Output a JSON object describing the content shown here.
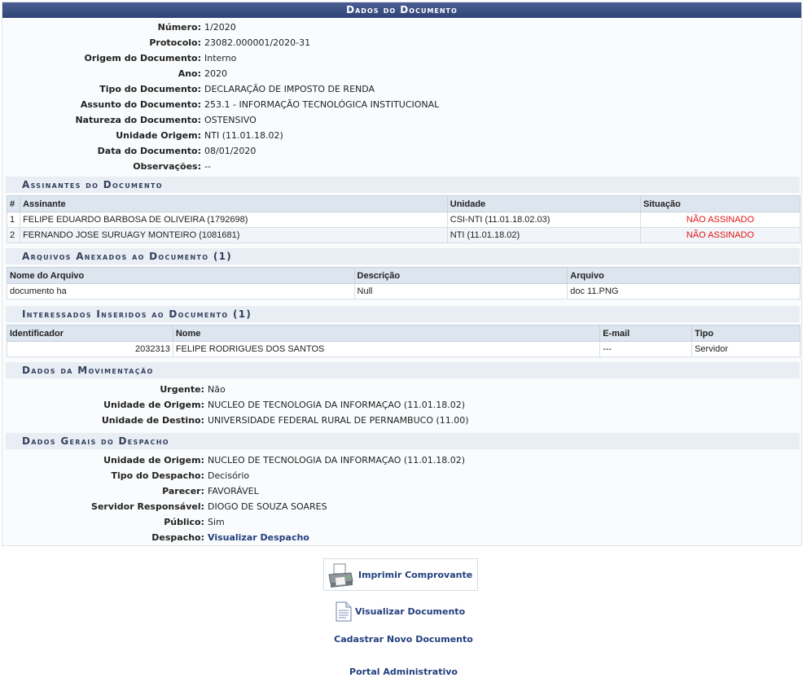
{
  "title": "Dados do Documento",
  "document": [
    {
      "label": "Número:",
      "value": "1/2020"
    },
    {
      "label": "Protocolo:",
      "value": "23082.000001/2020-31"
    },
    {
      "label": "Origem do Documento:",
      "value": "Interno"
    },
    {
      "label": "Ano:",
      "value": "2020"
    },
    {
      "label": "Tipo do Documento:",
      "value": "DECLARAÇÃO DE IMPOSTO DE RENDA"
    },
    {
      "label": "Assunto do Documento:",
      "value": "253.1 - INFORMAÇÃO TECNOLÓGICA INSTITUCIONAL"
    },
    {
      "label": "Natureza do Documento:",
      "value": "OSTENSIVO"
    },
    {
      "label": "Unidade Origem:",
      "value": "NTI (11.01.18.02)"
    },
    {
      "label": "Data do Documento:",
      "value": "08/01/2020"
    },
    {
      "label": "Observações:",
      "value": "--"
    }
  ],
  "signers": {
    "heading": "Assinantes do Documento",
    "columns": [
      "#",
      "Assinante",
      "Unidade",
      "Situação"
    ],
    "rows": [
      {
        "n": "1",
        "name": "FELIPE EDUARDO BARBOSA DE OLIVEIRA (1792698)",
        "unit": "CSI-NTI (11.01.18.02.03)",
        "status": "NÃO ASSINADO"
      },
      {
        "n": "2",
        "name": "FERNANDO JOSE SURUAGY MONTEIRO (1081681)",
        "unit": "NTI (11.01.18.02)",
        "status": "NÃO ASSINADO"
      }
    ]
  },
  "attachments": {
    "heading": "Arquivos Anexados ao Documento (1)",
    "columns": [
      "Nome do Arquivo",
      "Descrição",
      "Arquivo"
    ],
    "rows": [
      {
        "name": "documento ha",
        "desc": "Null",
        "file": "doc 11.PNG"
      }
    ]
  },
  "interested": {
    "heading": "Interessados Inseridos ao Documento (1)",
    "columns": [
      "Identificador",
      "Nome",
      "E-mail",
      "Tipo"
    ],
    "rows": [
      {
        "id": "2032313",
        "name": "FELIPE RODRIGUES DOS SANTOS",
        "email": "---",
        "type": "Servidor"
      }
    ]
  },
  "movement": {
    "heading": "Dados da Movimentação",
    "items": [
      {
        "label": "Urgente:",
        "value": "Não"
      },
      {
        "label": "Unidade de Origem:",
        "value": "NUCLEO DE TECNOLOGIA DA INFORMAÇAO (11.01.18.02)"
      },
      {
        "label": "Unidade de Destino:",
        "value": "UNIVERSIDADE FEDERAL RURAL DE PERNAMBUCO (11.00)"
      }
    ]
  },
  "dispatch": {
    "heading": "Dados Gerais do Despacho",
    "items": [
      {
        "label": "Unidade de Origem:",
        "value": "NUCLEO DE TECNOLOGIA DA INFORMAÇAO (11.01.18.02)"
      },
      {
        "label": "Tipo do Despacho:",
        "value": "Decisório"
      },
      {
        "label": "Parecer:",
        "value": "FAVORÁVEL"
      },
      {
        "label": "Servidor Responsável:",
        "value": "DIOGO DE SOUZA SOARES"
      },
      {
        "label": "Público:",
        "value": "Sim"
      }
    ],
    "despacho_label": "Despacho:",
    "despacho_link": "Visualizar Despacho"
  },
  "actions": {
    "print": "Imprimir Comprovante",
    "view_document": "Visualizar Documento",
    "new_document": "Cadastrar Novo Documento",
    "admin_portal": "Portal Administrativo"
  }
}
